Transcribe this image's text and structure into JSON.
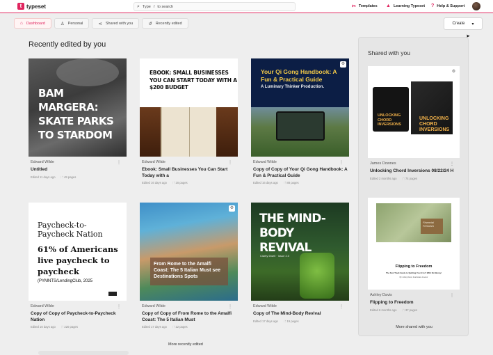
{
  "app": {
    "logo_mark": "t",
    "name": "typeset"
  },
  "search": {
    "prefix": "Type",
    "shortcut": "/",
    "suffix": "to search"
  },
  "nav": [
    {
      "label": "Templates",
      "icon": "templates-icon"
    },
    {
      "label": "Learning Typeset",
      "icon": "graduation-cap-icon"
    },
    {
      "label": "Help & Support",
      "icon": "help-icon"
    }
  ],
  "tabs": [
    {
      "label": "Dashboard",
      "icon": "home-icon",
      "active": true
    },
    {
      "label": "Personal",
      "icon": "user-icon",
      "active": false
    },
    {
      "label": "Shared with you",
      "icon": "share-icon",
      "active": false
    },
    {
      "label": "Recently edited",
      "icon": "history-icon",
      "active": false
    }
  ],
  "create": {
    "label": "Create",
    "caret": "▾"
  },
  "recent": {
    "title": "Recently edited by you",
    "more_label": "More recently edited",
    "cards": [
      {
        "author": "Edward Wilde",
        "title": "Untitled",
        "edited": "Edited 11 days ago",
        "pages": "49 pages",
        "cover": {
          "lines": [
            "BAM MARGERA:",
            "SKATE PARKS",
            "TO STARDOM"
          ]
        }
      },
      {
        "author": "Edward Wilde",
        "title": "Ebook: Small Businesses You Can Start Today with a",
        "edited": "Edited 16 days ago",
        "pages": "16 pages",
        "cover": {
          "text": "EBOOK: SMALL BUSINESSES YOU CAN START TODAY WITH A $200 BUDGET"
        }
      },
      {
        "author": "Edward Wilde",
        "title": "Copy of Copy of Your Qi Gong Handbook: A Fun & Practical Guide",
        "edited": "Edited 16 days ago",
        "pages": "88 pages",
        "cover": {
          "text": "Your Qi Gong Handbook: A Fun & Practical Guide",
          "subtitle": "A Luminary Thinker Production."
        }
      },
      {
        "author": "Edward Wilde",
        "title": "Copy of Copy of Paycheck-to-Paycheck Nation",
        "edited": "Edited 16 days ago",
        "pages": "220 pages",
        "cover": {
          "line1": "Paycheck-to-Paycheck Nation",
          "line2": "61% of Americans live paycheck to paycheck",
          "source": "(PYMNTS/LendingClub, 2025"
        }
      },
      {
        "author": "Edward Wilde",
        "title": "Copy of Copy of From Rome to the Amalfi Coast: The 5 Italian Must",
        "edited": "Edited 17 days ago",
        "pages": "12 pages",
        "cover": {
          "text": "From Rome to the Amalfi Coast: The 5 Italian Must see Destinations Spots"
        }
      },
      {
        "author": "Edward Wilde",
        "title": "Copy of The Mind-Body Revival",
        "edited": "Edited 17 days ago",
        "pages": "19 pages",
        "cover": {
          "text": "THE MIND-BODY REVIVAL",
          "subtitle": "Clarity Dwell · Issue 2.0"
        }
      }
    ]
  },
  "shared": {
    "title": "Shared with you",
    "more_label": "More shared with you",
    "cards": [
      {
        "author": "James Downes",
        "title": "Unlocking Chord Inversions 08/22/24 H",
        "edited": "Edited 2 months ago",
        "pages": "74 pages",
        "cover": {
          "text": "UNLOCKING CHORD INVERSIONS"
        }
      },
      {
        "author": "Ashley Davis",
        "title": "Flipping to Freedom",
        "edited": "Edited 6 months ago",
        "pages": "37 pages",
        "cover": {
          "text": "Flipping to Freedom",
          "subtitle": "The Fast Track Guide to Quitting Your 9 to 5 With No Money!",
          "byline": "By: Ashley Davis, Real Estate Investor",
          "tag": "Financial Freedom"
        }
      }
    ]
  },
  "colors": {
    "accent": "#e0245e"
  }
}
